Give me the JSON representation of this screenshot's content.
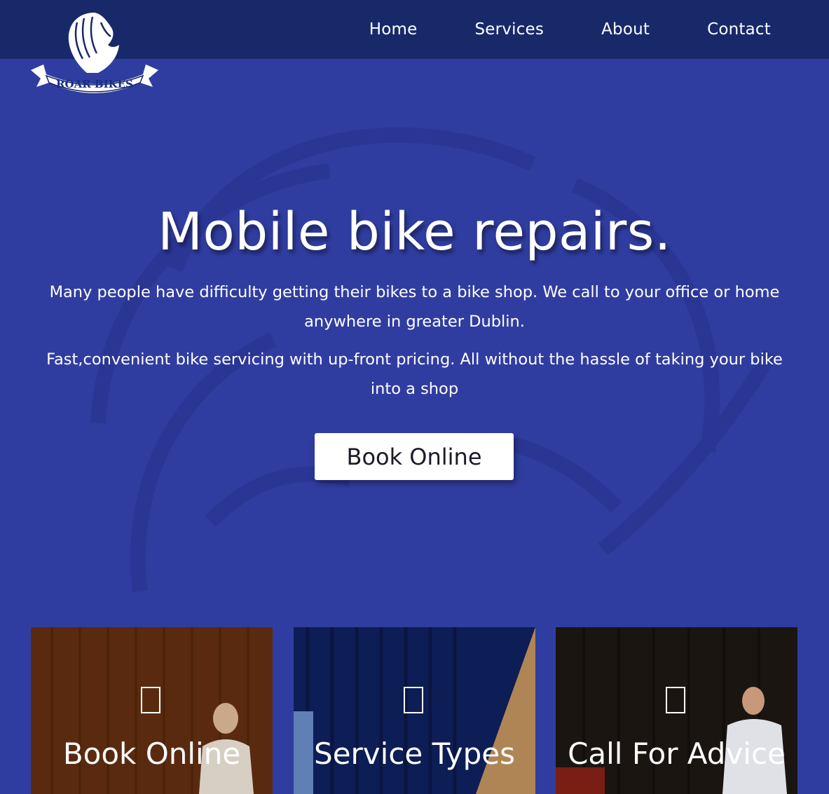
{
  "brand": {
    "logo_text": "ROAR BIKES"
  },
  "nav": {
    "items": [
      {
        "label": "Home"
      },
      {
        "label": "Services"
      },
      {
        "label": "About"
      },
      {
        "label": "Contact"
      }
    ]
  },
  "hero": {
    "title": "Mobile bike repairs.",
    "paragraph_1": "Many people have difficulty getting their bikes to a bike shop. We call to your office or home anywhere in greater Dublin.",
    "paragraph_2": "Fast,convenient bike servicing with up-front pricing. All without the hassle of taking your bike into a shop",
    "cta_label": "Book Online"
  },
  "cards": [
    {
      "title": "Book Online",
      "icon": "calendar-icon"
    },
    {
      "title": "Service Types",
      "icon": "document-icon"
    },
    {
      "title": "Call For Advice",
      "icon": "phone-icon"
    }
  ],
  "colors": {
    "hero_bg": "#303da0",
    "nav_bg": "#18296a",
    "button_bg": "#ffffff"
  }
}
